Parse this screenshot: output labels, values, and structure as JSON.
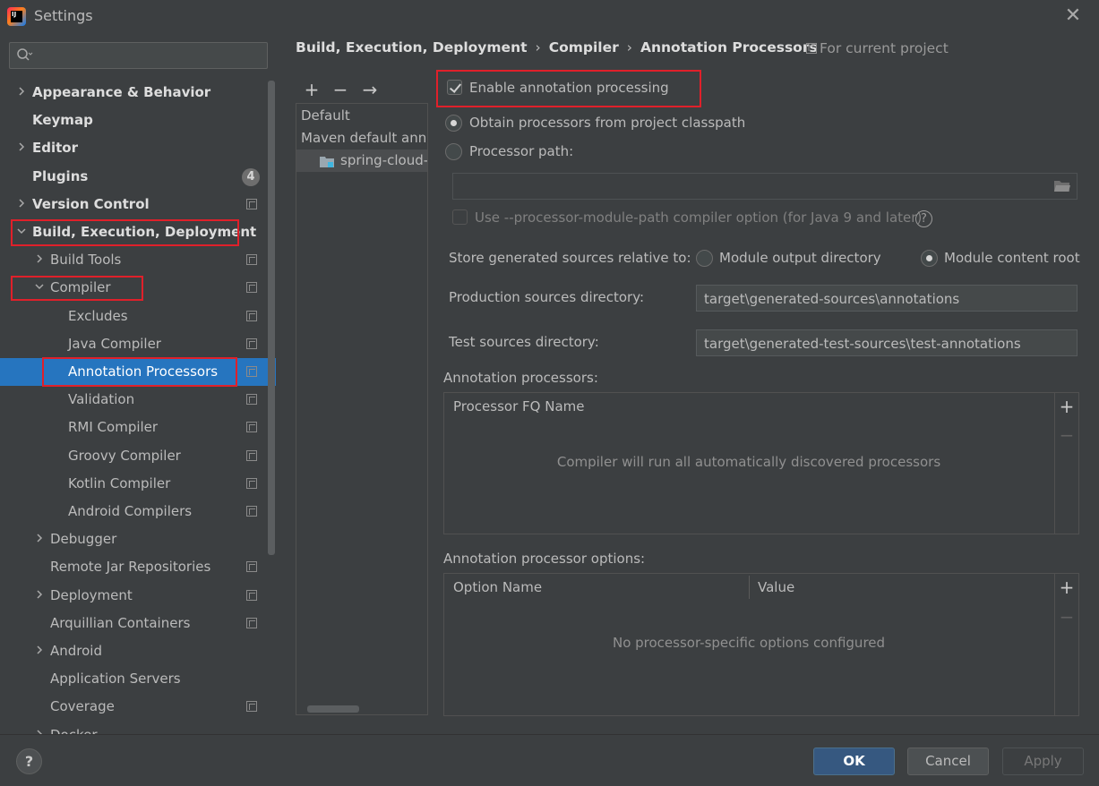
{
  "window": {
    "title": "Settings",
    "app_icon": "intellij-idea-icon"
  },
  "search": {
    "placeholder": "",
    "icon": "search-icon"
  },
  "sidebar": {
    "items": [
      {
        "label": "Appearance & Behavior",
        "arrow": ">",
        "bold": true,
        "level": 0
      },
      {
        "label": "Keymap",
        "arrow": "",
        "bold": true,
        "level": 0
      },
      {
        "label": "Editor",
        "arrow": ">",
        "bold": true,
        "level": 0
      },
      {
        "label": "Plugins",
        "arrow": "",
        "bold": true,
        "level": 0,
        "badge": "4"
      },
      {
        "label": "Version Control",
        "arrow": ">",
        "bold": true,
        "level": 0,
        "project": true
      },
      {
        "label": "Build, Execution, Deployment",
        "arrow": "v",
        "bold": true,
        "level": 0
      },
      {
        "label": "Build Tools",
        "arrow": ">",
        "level": 1,
        "project": true
      },
      {
        "label": "Compiler",
        "arrow": "v",
        "level": 1,
        "project": true
      },
      {
        "label": "Excludes",
        "arrow": "",
        "level": 2,
        "project": true
      },
      {
        "label": "Java Compiler",
        "arrow": "",
        "level": 2,
        "project": true
      },
      {
        "label": "Annotation Processors",
        "arrow": "",
        "level": 2,
        "project": true,
        "selected": true
      },
      {
        "label": "Validation",
        "arrow": "",
        "level": 2,
        "project": true
      },
      {
        "label": "RMI Compiler",
        "arrow": "",
        "level": 2,
        "project": true
      },
      {
        "label": "Groovy Compiler",
        "arrow": "",
        "level": 2,
        "project": true
      },
      {
        "label": "Kotlin Compiler",
        "arrow": "",
        "level": 2,
        "project": true
      },
      {
        "label": "Android Compilers",
        "arrow": "",
        "level": 2,
        "project": true
      },
      {
        "label": "Debugger",
        "arrow": ">",
        "level": 1
      },
      {
        "label": "Remote Jar Repositories",
        "arrow": "",
        "level": 1,
        "project": true
      },
      {
        "label": "Deployment",
        "arrow": ">",
        "level": 1,
        "project": true
      },
      {
        "label": "Arquillian Containers",
        "arrow": "",
        "level": 1,
        "project": true
      },
      {
        "label": "Android",
        "arrow": ">",
        "level": 1
      },
      {
        "label": "Application Servers",
        "arrow": "",
        "level": 1
      },
      {
        "label": "Coverage",
        "arrow": "",
        "level": 1,
        "project": true
      },
      {
        "label": "Docker",
        "arrow": ">",
        "level": 1
      }
    ]
  },
  "breadcrumb": {
    "items": [
      "Build, Execution, Deployment",
      "Compiler",
      "Annotation Processors"
    ],
    "separator": "›",
    "scope_label": "For current project"
  },
  "profiles": {
    "toolbar": {
      "add": "+",
      "remove": "−",
      "move": "→"
    },
    "rows": [
      "Default",
      "Maven default annotation processors profile",
      "spring-cloud-"
    ]
  },
  "form": {
    "enable_processing": {
      "label": "Enable annotation processing",
      "checked": true
    },
    "obtain_classpath": {
      "label": "Obtain processors from project classpath",
      "selected": true
    },
    "processor_path": {
      "label": "Processor path:",
      "selected": false,
      "value": ""
    },
    "module_path_option": {
      "label": "Use --processor-module-path compiler option (for Java 9 and later)",
      "checked": false,
      "help": "?"
    },
    "store_relative": {
      "label": "Store generated sources relative to:",
      "option_output": "Module output directory",
      "option_content": "Module content root",
      "selected": "Module content root"
    },
    "production_dir": {
      "label": "Production sources directory:",
      "value": "target\\generated-sources\\annotations"
    },
    "test_dir": {
      "label": "Test sources directory:",
      "value": "target\\generated-test-sources\\test-annotations"
    },
    "processors": {
      "label": "Annotation processors:",
      "column": "Processor FQ Name",
      "empty": "Compiler will run all automatically discovered processors",
      "add": "+",
      "remove": "−"
    },
    "options": {
      "label": "Annotation processor options:",
      "col_name": "Option Name",
      "col_value": "Value",
      "empty": "No processor-specific options configured",
      "add": "+",
      "remove": "−"
    }
  },
  "buttons": {
    "help": "?",
    "ok": "OK",
    "cancel": "Cancel",
    "apply": "Apply"
  },
  "colors": {
    "background": "#3c3f41",
    "selection": "#2675bf",
    "highlight_box": "#e0202a",
    "ok_button": "#365880"
  }
}
